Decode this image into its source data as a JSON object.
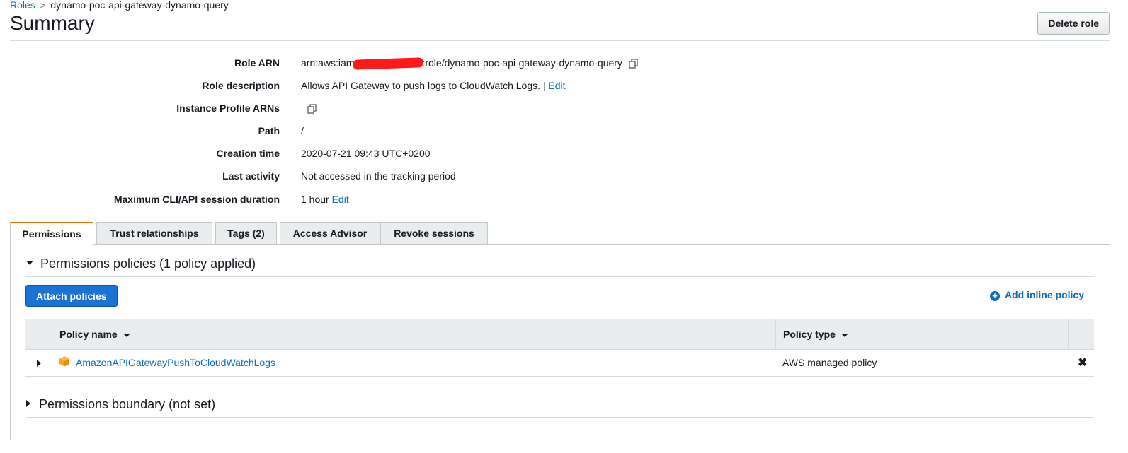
{
  "breadcrumb": {
    "root": "Roles",
    "separator": ">",
    "current": "dynamo-poc-api-gateway-dynamo-query"
  },
  "page_title": "Summary",
  "delete_button": "Delete role",
  "summary": {
    "role_arn": {
      "label": "Role ARN",
      "prefix": "arn:aws:iam",
      "suffix": ":role/dynamo-poc-api-gateway-dynamo-query"
    },
    "role_description": {
      "label": "Role description",
      "value": "Allows API Gateway to push logs to CloudWatch Logs.",
      "divider": "|",
      "edit": "Edit"
    },
    "instance_profile": {
      "label": "Instance Profile ARNs"
    },
    "path": {
      "label": "Path",
      "value": "/"
    },
    "creation_time": {
      "label": "Creation time",
      "value": "2020-07-21 09:43 UTC+0200"
    },
    "last_activity": {
      "label": "Last activity",
      "value": "Not accessed in the tracking period"
    },
    "max_session": {
      "label": "Maximum CLI/API session duration",
      "value": "1 hour",
      "edit": "Edit"
    }
  },
  "tabs": [
    {
      "label": "Permissions",
      "active": true
    },
    {
      "label": "Trust relationships"
    },
    {
      "label": "Tags (2)"
    },
    {
      "label": "Access Advisor"
    },
    {
      "label": "Revoke sessions"
    }
  ],
  "permissions": {
    "heading": "Permissions policies (1 policy applied)",
    "attach_button": "Attach policies",
    "add_inline": "Add inline policy",
    "columns": {
      "name": "Policy name",
      "type": "Policy type"
    },
    "rows": [
      {
        "name": "AmazonAPIGatewayPushToCloudWatchLogs",
        "type": "AWS managed policy"
      }
    ],
    "boundary_heading": "Permissions boundary (not set)"
  },
  "colors": {
    "link": "#0d6ebd",
    "primary_button": "#1a73d2",
    "active_tab_accent": "#ec7211",
    "policy_icon": "#f5a623"
  }
}
